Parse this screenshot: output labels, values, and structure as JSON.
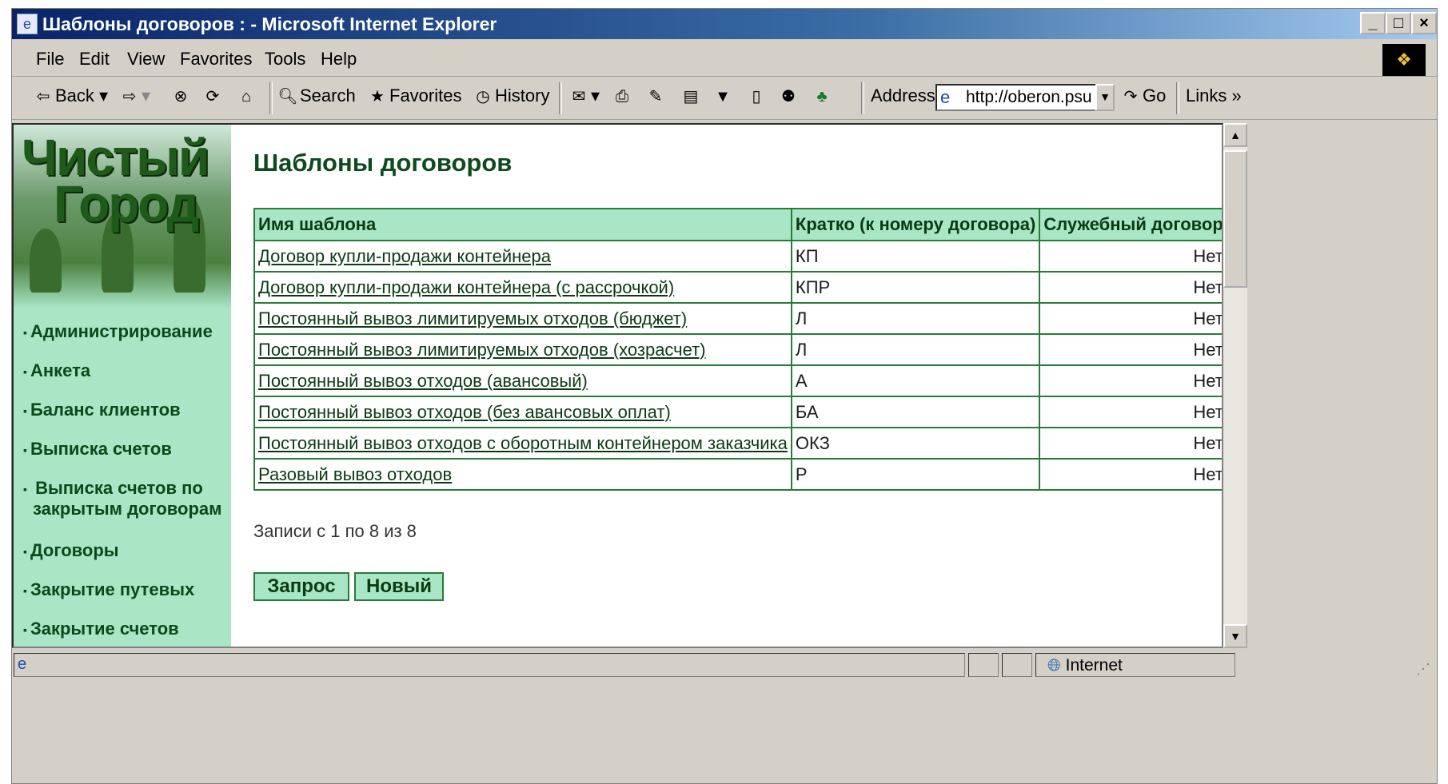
{
  "window": {
    "title": "Шаблоны договоров : - Microsoft Internet Explorer"
  },
  "menu": [
    "File",
    "Edit",
    "View",
    "Favorites",
    "Tools",
    "Help"
  ],
  "toolbar": {
    "back": "Back",
    "search": "Search",
    "favorites": "Favorites",
    "history": "History",
    "address_label": "Address",
    "address_value": "http://oberon.psu",
    "go": "Go",
    "links": "Links"
  },
  "sidebar": {
    "logo_line1": "Чистый",
    "logo_line2": "Город",
    "items": [
      "Администрирование",
      "Анкета",
      "Баланс клиентов",
      "Выписка счетов",
      "Выписка счетов по",
      "закрытым договорам",
      "Договоры",
      "Закрытие путевых",
      "Закрытие счетов"
    ]
  },
  "page": {
    "title": "Шаблоны договоров",
    "columns": [
      "Имя шаблона",
      "Кратко (к номеру договора)",
      "Служебный договор"
    ],
    "rows": [
      {
        "name": "Договор купли-продажи контейнера",
        "short": "КП",
        "service": "Нет"
      },
      {
        "name": "Договор купли-продажи контейнера (с рассрочкой)",
        "short": "КПР",
        "service": "Нет"
      },
      {
        "name": "Постоянный вывоз лимитируемых отходов (бюджет)",
        "short": "Л",
        "service": "Нет"
      },
      {
        "name": "Постоянный вывоз лимитируемых отходов (хозрасчет)",
        "short": "Л",
        "service": "Нет"
      },
      {
        "name": "Постоянный вывоз отходов (авансовый)",
        "short": "А",
        "service": "Нет"
      },
      {
        "name": "Постоянный вывоз отходов (без авансовых оплат)",
        "short": "БА",
        "service": "Нет"
      },
      {
        "name": "Постоянный вывоз отходов с оборотным контейнером заказчика",
        "short": "ОКЗ",
        "service": "Нет"
      },
      {
        "name": "Разовый вывоз отходов",
        "short": "Р",
        "service": "Нет"
      }
    ],
    "records_text": "Записи с 1 по 8 из 8",
    "query_button": "Запрос",
    "new_button": "Новый"
  },
  "status": {
    "zone": "Internet"
  },
  "colors": {
    "accent": "#a8e6c5",
    "border": "#2a7a3a",
    "title": "#0d4a1d"
  }
}
